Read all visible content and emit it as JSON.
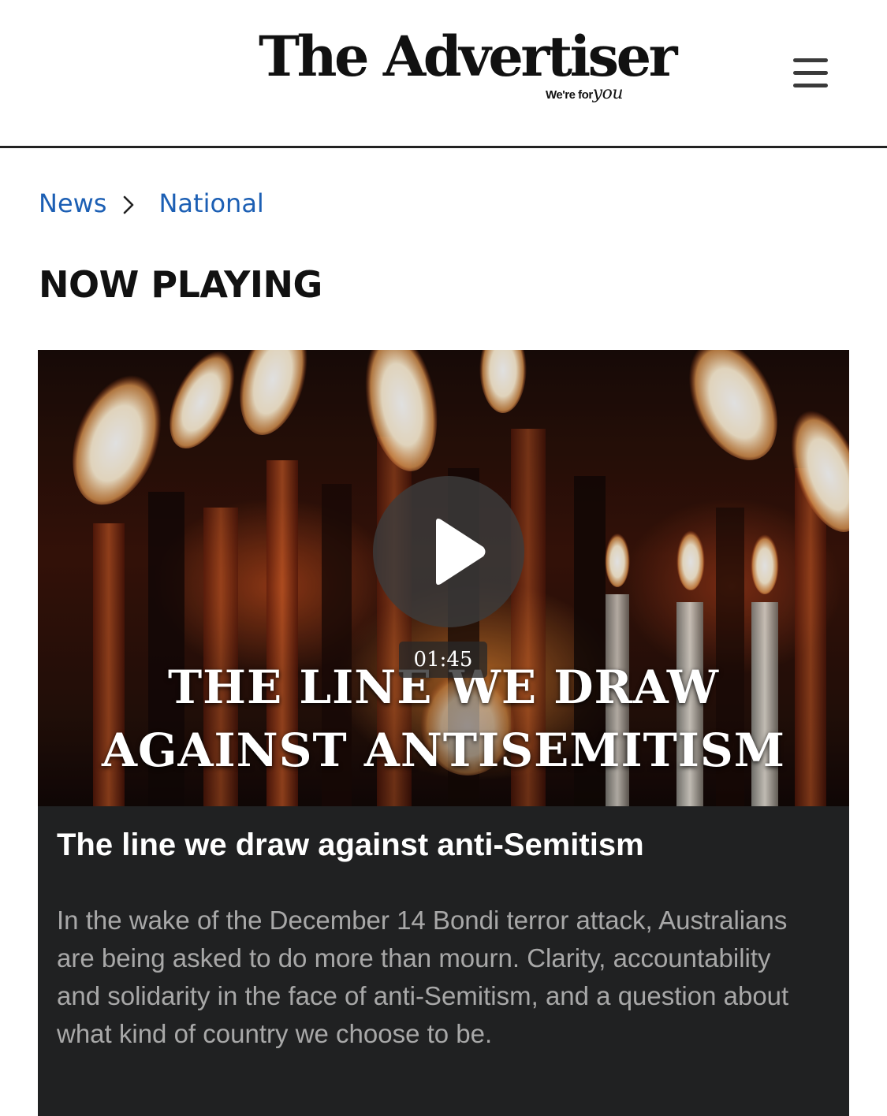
{
  "header": {
    "logo_text": "The Advertiser",
    "tagline_prefix": "We're for",
    "tagline_script": "you",
    "menu_icon": "hamburger-menu-icon"
  },
  "breadcrumb": {
    "items": [
      {
        "label": "News"
      },
      {
        "label": "National"
      }
    ],
    "separator_icon": "chevron-right-icon"
  },
  "section": {
    "title": "NOW PLAYING"
  },
  "video": {
    "thumbnail_title_line1": "THE LINE WE DRAW",
    "thumbnail_title_line2": "AGAINST ANTISEMITISM",
    "duration": "01:45",
    "play_icon": "play-icon",
    "heading": "The line we draw against anti-Semitism",
    "description": "In the wake of the December 14 Bondi terror attack, Australians are being asked to do more than mourn. Clarity, accountability and solidarity in the face of anti-Semitism, and a question about what kind of country we choose to be."
  },
  "colors": {
    "link": "#1c5fb4",
    "card_background": "#202122",
    "description_text": "#a8a8a8",
    "header_rule": "#222222"
  }
}
